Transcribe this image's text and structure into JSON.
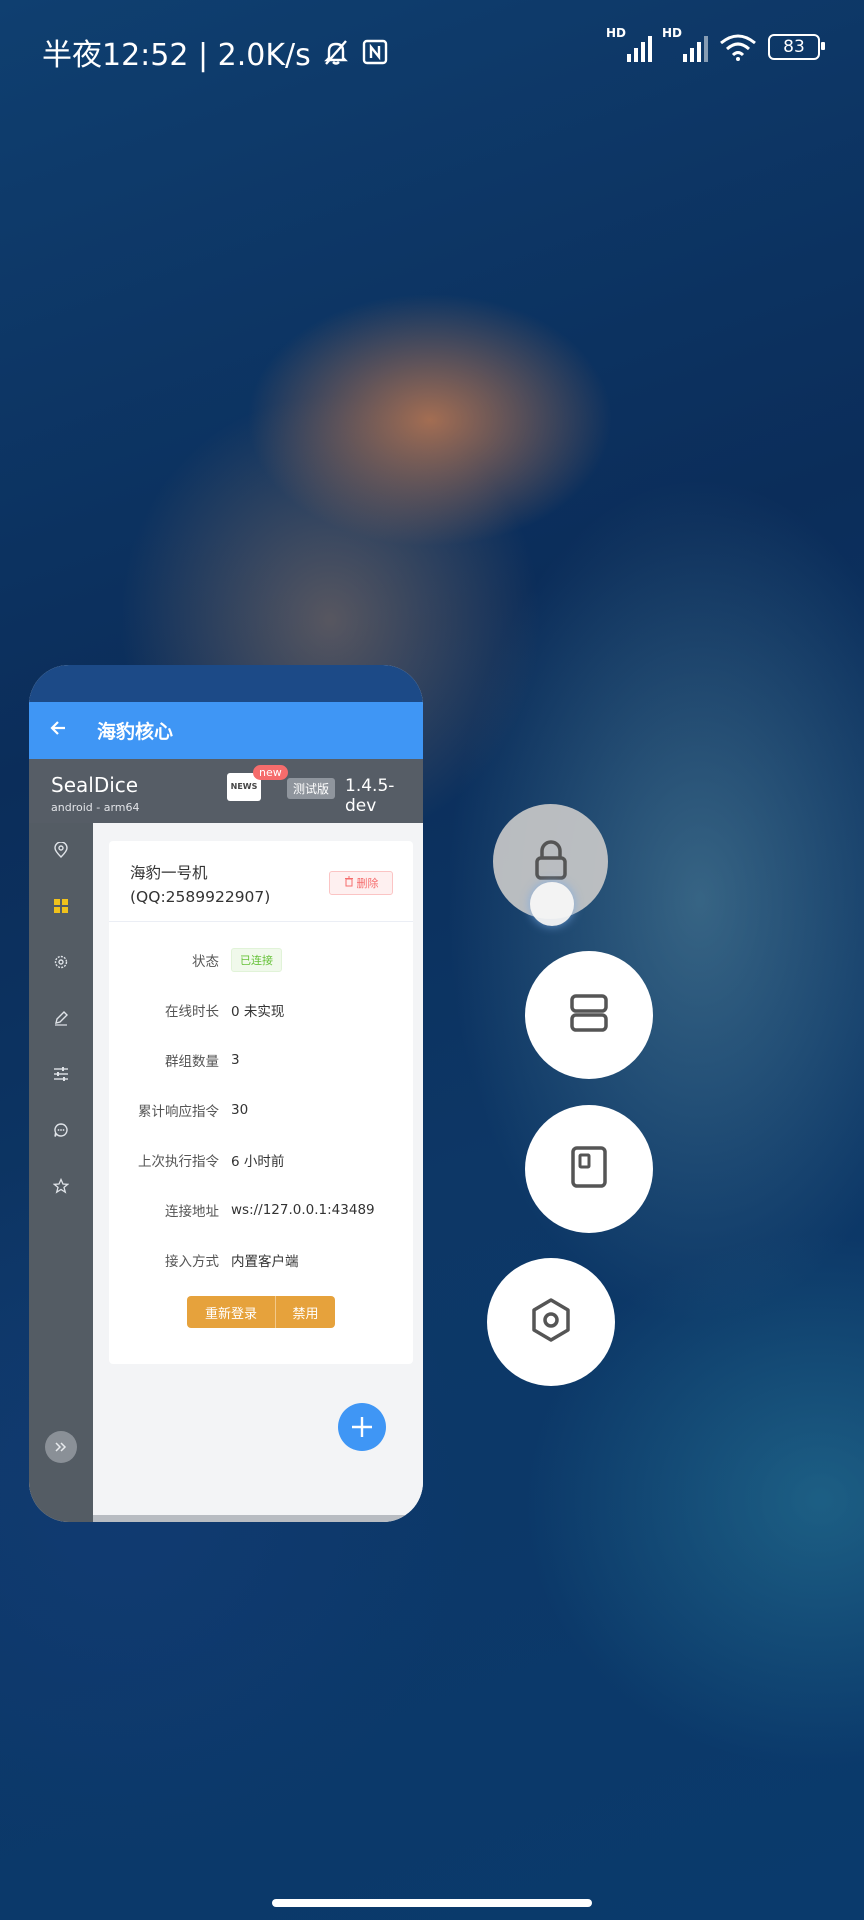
{
  "status_bar": {
    "time_speed": "半夜12:52 | 2.0K/s",
    "signal1_label": "HD",
    "signal2_label": "HD",
    "battery": "83"
  },
  "app": {
    "title": "海豹核心",
    "brand": "SealDice",
    "platform": "android - arm64",
    "news_label": "NEWS",
    "new_badge": "new",
    "test_badge": "测试版",
    "version": "1.4.5-dev",
    "nav_icons": [
      "location-icon",
      "dashboard-icon",
      "gear-icon",
      "pen-icon",
      "sliders-icon",
      "chat-icon",
      "star-icon"
    ],
    "account": {
      "title": "海豹一号机(QQ:2589922907)",
      "delete_label": "删除",
      "fields": [
        {
          "label": "状态",
          "value": "已连接"
        },
        {
          "label": "在线时长",
          "value": "0 未实现"
        },
        {
          "label": "群组数量",
          "value": "3"
        },
        {
          "label": "累计响应指令",
          "value": "30"
        },
        {
          "label": "上次执行指令",
          "value": "6 小时前"
        },
        {
          "label": "连接地址",
          "value": "ws://127.0.0.1:43489"
        },
        {
          "label": "接入方式",
          "value": "内置客户端"
        }
      ],
      "relogin_label": "重新登录",
      "disable_label": "禁用"
    }
  },
  "colors": {
    "primary": "#3f96f5",
    "warning": "#e6a23c",
    "danger": "#f56c6c",
    "success": "#67c23a",
    "sidebar": "#545c64"
  }
}
